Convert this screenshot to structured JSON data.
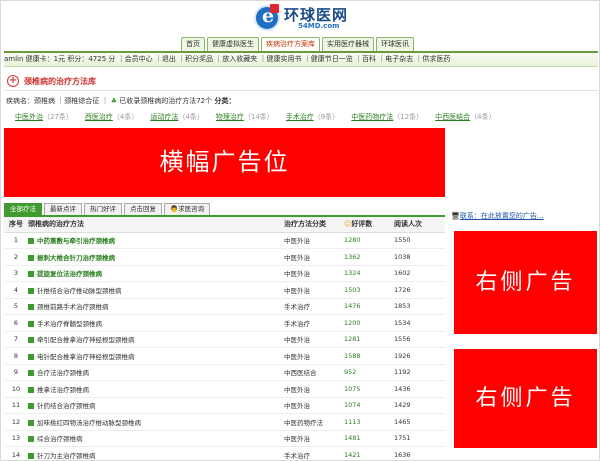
{
  "logo": {
    "name": "环球医网",
    "sub": "54MD.com"
  },
  "tabs": [
    "首页",
    "健康虚拟医生",
    "疾病治疗方案库",
    "实用医疗器械",
    "环球医讯"
  ],
  "navbar": "amlin 健康卡：1元  积分：4725 分 ｜会员中心 ｜退出 ｜积分奖品 ｜放入收藏夹 ｜健康实用书 ｜健康节日一览 ｜百科 ｜电子杂志 ｜供求医药",
  "page_title": "颈椎病的治疗方法库",
  "crumb": {
    "prefix": "疾病名：颈椎病 ｜颈椎综合征 ｜",
    "text": "已收录颈椎病的治疗方法72个",
    "label": "分类："
  },
  "categories": [
    {
      "name": "中医外治",
      "count": "（27条）"
    },
    {
      "name": "西医治疗",
      "count": "（4条）"
    },
    {
      "name": "运动疗法",
      "count": "（4条）"
    },
    {
      "name": "物理治疗",
      "count": "（14条）"
    },
    {
      "name": "手术治疗",
      "count": "（9条）"
    },
    {
      "name": "中医药物疗法",
      "count": "（12条）"
    },
    {
      "name": "中西医结合",
      "count": "（4条）"
    }
  ],
  "banner": "横幅广告位",
  "table_tabs": [
    "全部疗法",
    "最新点评",
    "热门好评",
    "点击回复",
    "求医咨询"
  ],
  "table": {
    "headers": [
      "序号",
      "颈椎病的治疗方法",
      "治疗方法分类",
      "好评数",
      "阅读人次"
    ],
    "rows": [
      {
        "no": "1",
        "name": "中药熏敷与牵引治疗颈椎病",
        "cat": "中医外治",
        "score": "1280",
        "reads": "1550",
        "top": true
      },
      {
        "no": "2",
        "name": "振刺大椎合针刀治疗颈椎病",
        "cat": "中医外治",
        "score": "1362",
        "reads": "1038",
        "top": true
      },
      {
        "no": "3",
        "name": "提旋复位法治疗颈椎病",
        "cat": "中医外治",
        "score": "1324",
        "reads": "1602",
        "top": true
      },
      {
        "no": "4",
        "name": "针推结合治疗椎动脉型颈椎病",
        "cat": "中医外治",
        "score": "1503",
        "reads": "1726",
        "top": false
      },
      {
        "no": "5",
        "name": "颈椎前路手术治疗颈椎病",
        "cat": "手术治疗",
        "score": "1476",
        "reads": "1853",
        "top": false
      },
      {
        "no": "6",
        "name": "手术治疗脊髓型颈椎病",
        "cat": "手术治疗",
        "score": "1200",
        "reads": "1534",
        "top": false
      },
      {
        "no": "7",
        "name": "牵引配合推拿治疗神经根型颈椎病",
        "cat": "中医外治",
        "score": "1281",
        "reads": "1556",
        "top": false
      },
      {
        "no": "8",
        "name": "电针配合推拿治疗神经根型颈椎病",
        "cat": "中医外治",
        "score": "1588",
        "reads": "1926",
        "top": false
      },
      {
        "no": "9",
        "name": "合疗法治疗颈椎病",
        "cat": "中西医结合",
        "score": "952",
        "reads": "1192",
        "top": false
      },
      {
        "no": "10",
        "name": "推拿法治疗颈椎病",
        "cat": "中医外治",
        "score": "1075",
        "reads": "1436",
        "top": false
      },
      {
        "no": "11",
        "name": "针药结合治疗颈椎病",
        "cat": "中医外治",
        "score": "1074",
        "reads": "1429",
        "top": false
      },
      {
        "no": "12",
        "name": "加味桃红四物汤治疗椎动脉型颈椎病",
        "cat": "中医药物疗法",
        "score": "1113",
        "reads": "1465",
        "top": false
      },
      {
        "no": "13",
        "name": "综合治疗颈椎病",
        "cat": "中医外治",
        "score": "1481",
        "reads": "1751",
        "top": false
      },
      {
        "no": "14",
        "name": "针刀为主治疗颈椎病",
        "cat": "手术治疗",
        "score": "1421",
        "reads": "1636",
        "top": false
      }
    ]
  },
  "contact": "联系：在此放置您的广告...",
  "ads": [
    "右侧广告",
    "右侧广告"
  ],
  "colors": {
    "accent": "#3f9a30",
    "banner": "#ff0000",
    "title": "#cc3333"
  }
}
